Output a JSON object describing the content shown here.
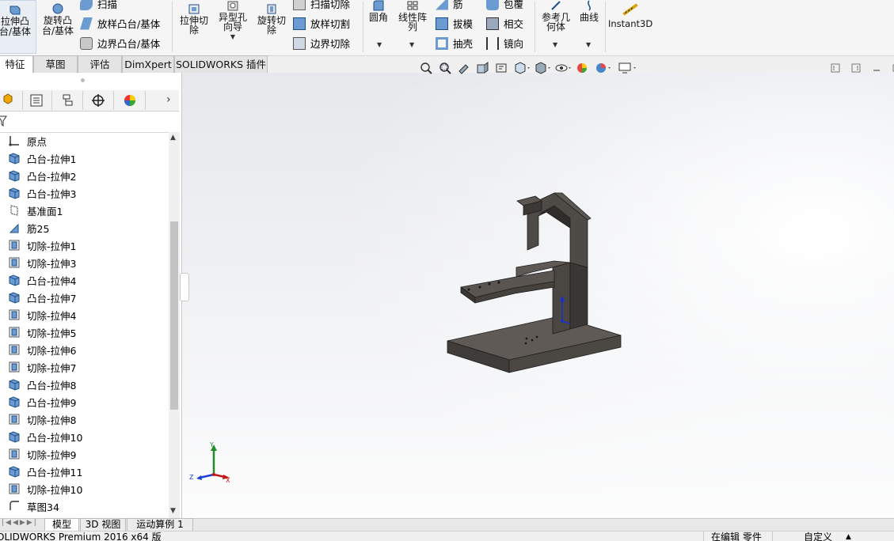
{
  "ribbon": {
    "extrude_boss": "拉伸凸\n台/基体",
    "revolve_boss": "旋转凸\n台/基体",
    "sweep": "扫描",
    "loft_boss": "放样凸台/基体",
    "boundary_boss": "边界凸台/基体",
    "extrude_cut": "拉伸切\n除",
    "hole_wizard": "异型孔\n向导",
    "revolve_cut": "旋转切\n除",
    "sweep_cut": "扫描切除",
    "loft_cut": "放样切割",
    "boundary_cut": "边界切除",
    "fillet": "圆角",
    "linear_pattern": "线性阵\n列",
    "rib": "筋",
    "draft": "拔模",
    "shell": "抽壳",
    "wrap": "包覆",
    "intersect": "相交",
    "mirror": "镜向",
    "ref_geometry": "参考几\n何体",
    "curves": "曲线",
    "instant3d": "Instant3D"
  },
  "tabs": [
    "特征",
    "草图",
    "评估",
    "DimXpert",
    "SOLIDWORKS 插件"
  ],
  "tree": {
    "items": [
      {
        "label": "原点",
        "icon": "origin-icon"
      },
      {
        "label": "凸台-拉伸1",
        "icon": "boss-extrude-icon"
      },
      {
        "label": "凸台-拉伸2",
        "icon": "boss-extrude-icon"
      },
      {
        "label": "凸台-拉伸3",
        "icon": "boss-extrude-icon"
      },
      {
        "label": "基准面1",
        "icon": "plane-icon"
      },
      {
        "label": "筋25",
        "icon": "rib-icon"
      },
      {
        "label": "切除-拉伸1",
        "icon": "cut-extrude-icon"
      },
      {
        "label": "切除-拉伸3",
        "icon": "cut-extrude-icon"
      },
      {
        "label": "凸台-拉伸4",
        "icon": "boss-extrude-icon"
      },
      {
        "label": "凸台-拉伸7",
        "icon": "boss-extrude-icon"
      },
      {
        "label": "切除-拉伸4",
        "icon": "cut-extrude-icon"
      },
      {
        "label": "切除-拉伸5",
        "icon": "cut-extrude-icon"
      },
      {
        "label": "切除-拉伸6",
        "icon": "cut-extrude-icon"
      },
      {
        "label": "切除-拉伸7",
        "icon": "cut-extrude-icon"
      },
      {
        "label": "凸台-拉伸8",
        "icon": "boss-extrude-icon"
      },
      {
        "label": "凸台-拉伸9",
        "icon": "boss-extrude-icon"
      },
      {
        "label": "切除-拉伸8",
        "icon": "cut-extrude-icon"
      },
      {
        "label": "凸台-拉伸10",
        "icon": "boss-extrude-icon"
      },
      {
        "label": "切除-拉伸9",
        "icon": "cut-extrude-icon"
      },
      {
        "label": "凸台-拉伸11",
        "icon": "boss-extrude-icon"
      },
      {
        "label": "切除-拉伸10",
        "icon": "cut-extrude-icon"
      },
      {
        "label": "草图34",
        "icon": "sketch-icon"
      }
    ]
  },
  "triad": {
    "x": "X",
    "y": "Y",
    "z": "Z"
  },
  "bottom_tabs": [
    "模型",
    "3D 视图",
    "运动算例 1"
  ],
  "status": {
    "app": "OLIDWORKS Premium 2016 x64 版",
    "editing": "在编辑 零件",
    "custom": "自定义"
  }
}
